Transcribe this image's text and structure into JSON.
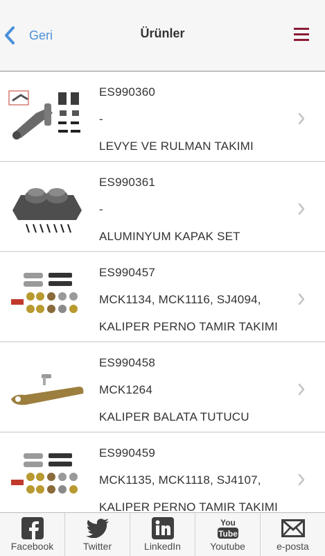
{
  "header": {
    "back_label": "Geri",
    "title": "Ürünler"
  },
  "products": [
    {
      "code": "ES990360",
      "refs": "-",
      "name": "LEVYE VE RULMAN TAKIMI"
    },
    {
      "code": "ES990361",
      "refs": "-",
      "name": "ALUMINYUM KAPAK SET"
    },
    {
      "code": "ES990457",
      "refs": "MCK1134, MCK1116, SJ4094,",
      "name": "KALIPER PERNO TAMIR TAKIMI"
    },
    {
      "code": "ES990458",
      "refs": "MCK1264",
      "name": "KALIPER BALATA TUTUCU"
    },
    {
      "code": "ES990459",
      "refs": "MCK1135, MCK1118, SJ4107,",
      "name": "KALIPER PERNO TAMIR TAKIMI"
    }
  ],
  "footer": {
    "tabs": [
      {
        "label": "Facebook",
        "icon": "facebook-icon"
      },
      {
        "label": "Twitter",
        "icon": "twitter-icon"
      },
      {
        "label": "LinkedIn",
        "icon": "linkedin-icon"
      },
      {
        "label": "Youtube",
        "icon": "youtube-icon",
        "icon_text_top": "You",
        "icon_text_bottom": "Tube"
      },
      {
        "label": "e-posta",
        "icon": "envelope-icon"
      }
    ]
  },
  "colors": {
    "accent_blue": "#4a90d9",
    "menu_red": "#8b1c36",
    "text": "#333333"
  }
}
